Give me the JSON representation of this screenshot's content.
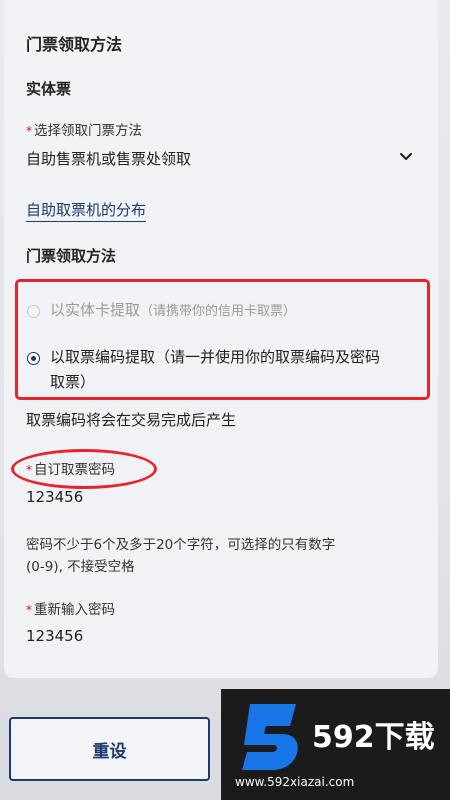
{
  "form": {
    "section_title": "门票领取方法",
    "physical_heading": "实体票",
    "select_label": "选择领取门票方法",
    "select_value": "自助售票机或售票处领取",
    "machines_link": "自助取票机的分布",
    "method_heading": "门票领取方法",
    "option_card": "以实体卡提取",
    "option_card_hint": "（请携带你的信用卡取票）",
    "option_code_line1": "以取票编码提取（请一并使用你的取票编码及密码",
    "option_code_line2": "取票）",
    "code_note": "取票编码将会在交易完成后产生",
    "password_label": "自订取票密码",
    "password_value": "123456",
    "password_hint_line1": "密码不少于6个及多于20个字符，可选择的只有数字",
    "password_hint_line2": "(0-9), 不接受空格",
    "confirm_label": "重新输入密码",
    "confirm_value": "123456",
    "required_mark": "*"
  },
  "actions": {
    "reset_label": "重设"
  },
  "watermark": {
    "badge_digit": "5",
    "brand": "592下载",
    "url": "www.592xiazai.com"
  },
  "icons": {
    "select_arrow": "chevron-down-icon"
  },
  "colors": {
    "accent": "#1e3a6d",
    "highlight": "#e8242a",
    "required": "#c8102e"
  },
  "state": {
    "selected_option": "option_code"
  }
}
